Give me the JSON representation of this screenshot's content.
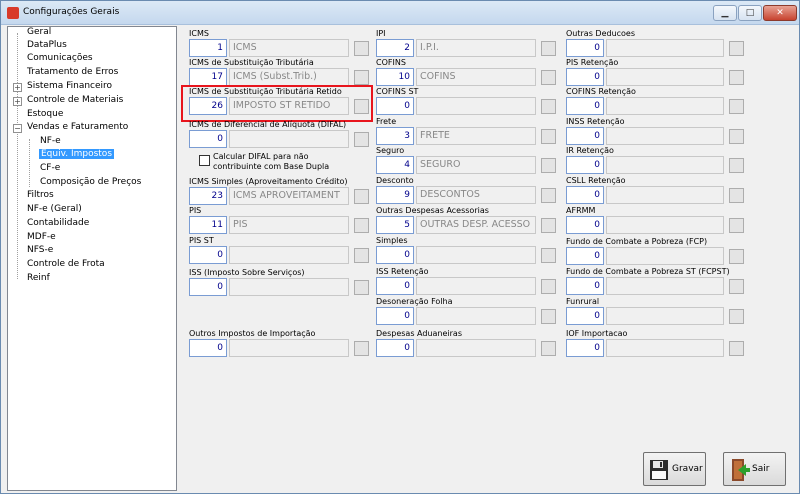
{
  "window": {
    "title": "Configurações Gerais"
  },
  "tree": {
    "items": [
      "Geral",
      "DataPlus",
      "Comunicações",
      "Tratamento de Erros",
      "Sistema Financeiro",
      "Controle de Materiais",
      "Estoque",
      "Vendas e Faturamento",
      "NF-e",
      "Equiv. Impostos",
      "CF-e",
      "Composição de Preços",
      "Filtros",
      "NF-e (Geral)",
      "Contabilidade",
      "MDF-e",
      "NFS-e",
      "Controle de Frota",
      "Reinf"
    ],
    "selected": "Equiv. Impostos"
  },
  "col1": {
    "icms": {
      "label": "ICMS",
      "code": "1",
      "desc": "ICMS"
    },
    "icms_st": {
      "label": "ICMS de Substituição Tributária",
      "code": "17",
      "desc": "ICMS (Subst.Trib.)"
    },
    "icms_st_ret": {
      "label": "ICMS de Substituição Tributária Retido",
      "code": "26",
      "desc": "IMPOSTO ST RETIDO"
    },
    "difal": {
      "label": "ICMS de Diferencial de Alíquota (DIFAL)",
      "code": "0",
      "desc": ""
    },
    "difal_check": {
      "line1": "Calcular DIFAL para não",
      "line2": "contribuinte com Base Dupla"
    },
    "icms_simples": {
      "label": "ICMS Simples (Aproveitamento Crédito)",
      "code": "23",
      "desc": "ICMS APROVEITAMENT"
    },
    "pis": {
      "label": "PIS",
      "code": "11",
      "desc": "PIS"
    },
    "pis_st": {
      "label": "PIS ST",
      "code": "0",
      "desc": ""
    },
    "iss": {
      "label": "ISS (Imposto Sobre Serviços)",
      "code": "0",
      "desc": ""
    },
    "outros_imp": {
      "label": "Outros Impostos de Importação",
      "code": "0",
      "desc": ""
    }
  },
  "col2": {
    "ipi": {
      "label": "IPI",
      "code": "2",
      "desc": "I.P.I."
    },
    "cofins": {
      "label": "COFINS",
      "code": "10",
      "desc": "COFINS"
    },
    "cofins_st": {
      "label": "COFINS ST",
      "code": "0",
      "desc": ""
    },
    "frete": {
      "label": "Frete",
      "code": "3",
      "desc": "FRETE"
    },
    "seguro": {
      "label": "Seguro",
      "code": "4",
      "desc": "SEGURO"
    },
    "desconto": {
      "label": "Desconto",
      "code": "9",
      "desc": "DESCONTOS"
    },
    "outras_desp": {
      "label": "Outras Despesas Acessorias",
      "code": "5",
      "desc": "OUTRAS DESP. ACESSO"
    },
    "simples": {
      "label": "Simples",
      "code": "0",
      "desc": ""
    },
    "iss_ret": {
      "label": "ISS Retenção",
      "code": "0",
      "desc": ""
    },
    "deson": {
      "label": "Desoneração Folha",
      "code": "0",
      "desc": ""
    },
    "desp_adu": {
      "label": "Despesas Aduaneiras",
      "code": "0",
      "desc": ""
    }
  },
  "col3": {
    "outras_ded": {
      "label": "Outras Deducoes",
      "code": "0",
      "desc": ""
    },
    "pis_ret": {
      "label": "PIS Retenção",
      "code": "0",
      "desc": ""
    },
    "cofins_ret": {
      "label": "COFINS Retenção",
      "code": "0",
      "desc": ""
    },
    "inss_ret": {
      "label": "INSS Retenção",
      "code": "0",
      "desc": ""
    },
    "ir_ret": {
      "label": "IR Retenção",
      "code": "0",
      "desc": ""
    },
    "csll_ret": {
      "label": "CSLL Retenção",
      "code": "0",
      "desc": ""
    },
    "afrmm": {
      "label": "AFRMM",
      "code": "0",
      "desc": ""
    },
    "fcp": {
      "label": "Fundo de Combate a Pobreza (FCP)",
      "code": "0",
      "desc": ""
    },
    "fcpst": {
      "label": "Fundo de Combate a Pobreza ST (FCPST)",
      "code": "0",
      "desc": ""
    },
    "funrural": {
      "label": "Funrural",
      "code": "0",
      "desc": ""
    },
    "iof": {
      "label": "IOF Importacao",
      "code": "0",
      "desc": ""
    }
  },
  "buttons": {
    "save": "Gravar",
    "exit": "Sair"
  },
  "colors": {
    "highlight": "#e8151d",
    "selection": "#3399ff"
  }
}
